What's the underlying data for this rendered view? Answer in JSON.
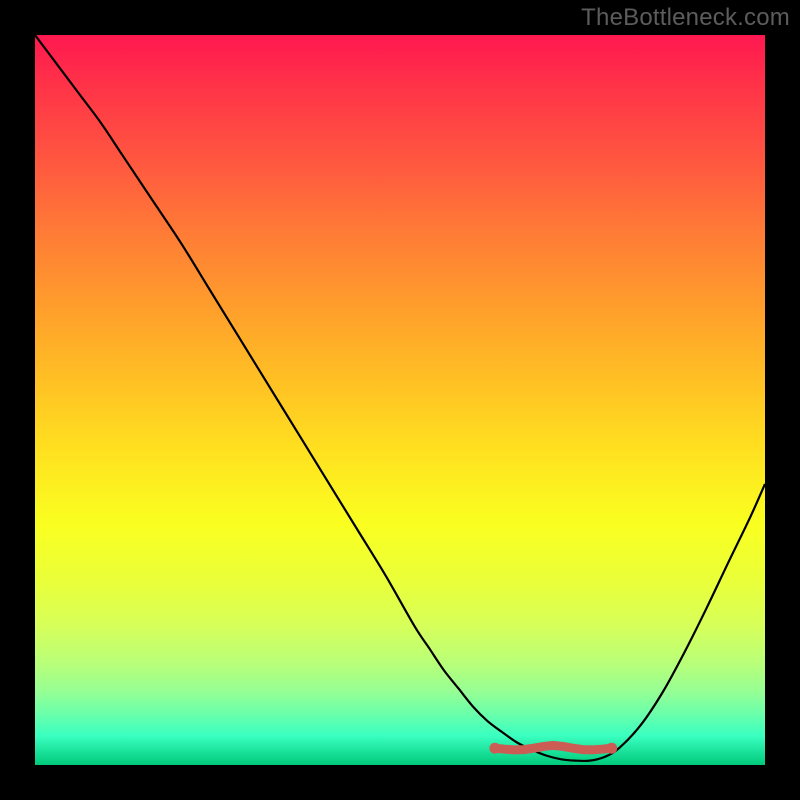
{
  "watermark": "TheBottleneck.com",
  "colors": {
    "background": "#000000",
    "curve": "#000000",
    "marker": "#cc5d55",
    "gradient_top": "#ff1850",
    "gradient_bottom": "#00c97a"
  },
  "chart_data": {
    "type": "line",
    "title": "",
    "xlabel": "",
    "ylabel": "",
    "xlim": [
      0,
      100
    ],
    "ylim": [
      0,
      100
    ],
    "x": [
      0,
      3,
      6,
      9,
      12,
      16,
      20,
      24,
      28,
      32,
      36,
      40,
      44,
      48,
      52,
      54,
      56,
      58,
      60,
      62,
      64,
      66,
      68,
      70,
      72,
      74,
      76,
      78,
      80,
      83,
      86,
      89,
      92,
      95,
      98,
      100
    ],
    "values": [
      100,
      96,
      92,
      88,
      83.5,
      77.5,
      71.5,
      65,
      58.5,
      52,
      45.5,
      39,
      32.5,
      26,
      19,
      16,
      13,
      10.5,
      8,
      6,
      4.5,
      3.1,
      2.1,
      1.3,
      0.8,
      0.6,
      0.6,
      1.1,
      2.3,
      5.5,
      10,
      15.5,
      21.5,
      27.8,
      34,
      38.5
    ],
    "optimal_range": {
      "start_x": 63,
      "end_x": 79,
      "y": 2.3
    },
    "description": "V-shaped bottleneck curve over a vertical heat gradient (red at top = high bottleneck, green at bottom = low). Minimum / flat optimal zone roughly between x=63 and x=79 at y≈2."
  }
}
